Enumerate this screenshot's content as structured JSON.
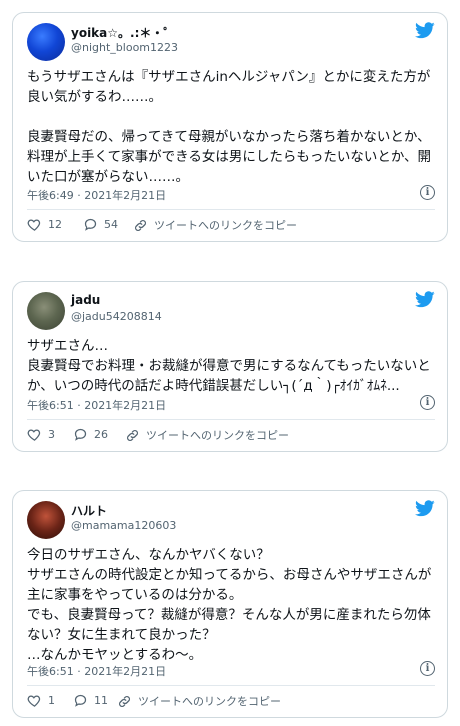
{
  "tweets": [
    {
      "name": "yoika☆。.:＊・゜",
      "handle": "@night_bloom1223",
      "text": "もうサザエさんは『サザエさんinヘルジャパン』とかに変えた方が良い気がするわ……。\n\n良妻賢母だの、帰ってきて母親がいなかったら落ち着かないとか、料理が上手くて家事ができる女は男にしたらもったいないとか、開いた口が塞がらない……。",
      "time": "午後6:49 · 2021年2月21日",
      "likes": "12",
      "replies": "54",
      "copy_link": "ツイートへのリンクをコピー"
    },
    {
      "name": "jadu",
      "handle": "@jadu54208814",
      "text": "サザエさん…\n良妻賢母でお料理・お裁縫が得意で男にするなんてもったいないとか、いつの時代の話だよ時代錯誤甚だしい┐(´д｀)┌ｵｲｶﾞｵﾑﾈ...",
      "time": "午後6:51 · 2021年2月21日",
      "likes": "3",
      "replies": "26",
      "copy_link": "ツイートへのリンクをコピー"
    },
    {
      "name": "ハルト",
      "handle": "@mamama120603",
      "text": "今日のサザエさん、なんかヤバくない？\nサザエさんの時代設定とか知ってるから、お母さんやサザエさんが主に家事をやっているのは分かる。\nでも、良妻賢母って？裁縫が得意？そんな人が男に産まれたら勿体ない？女に生まれて良かった？\n…なんかモヤッとするわ〜。",
      "time": "午後6:51 · 2021年2月21日",
      "likes": "1",
      "replies": "11",
      "copy_link": "ツイートへのリンクをコピー"
    }
  ],
  "colors": {
    "twitter_blue": "#1d9bf0",
    "secondary_text": "#536471",
    "border": "#cfd9de"
  },
  "icons": [
    "avatar",
    "twitter-bird-icon",
    "info-icon",
    "heart-icon",
    "reply-icon",
    "link-icon"
  ]
}
